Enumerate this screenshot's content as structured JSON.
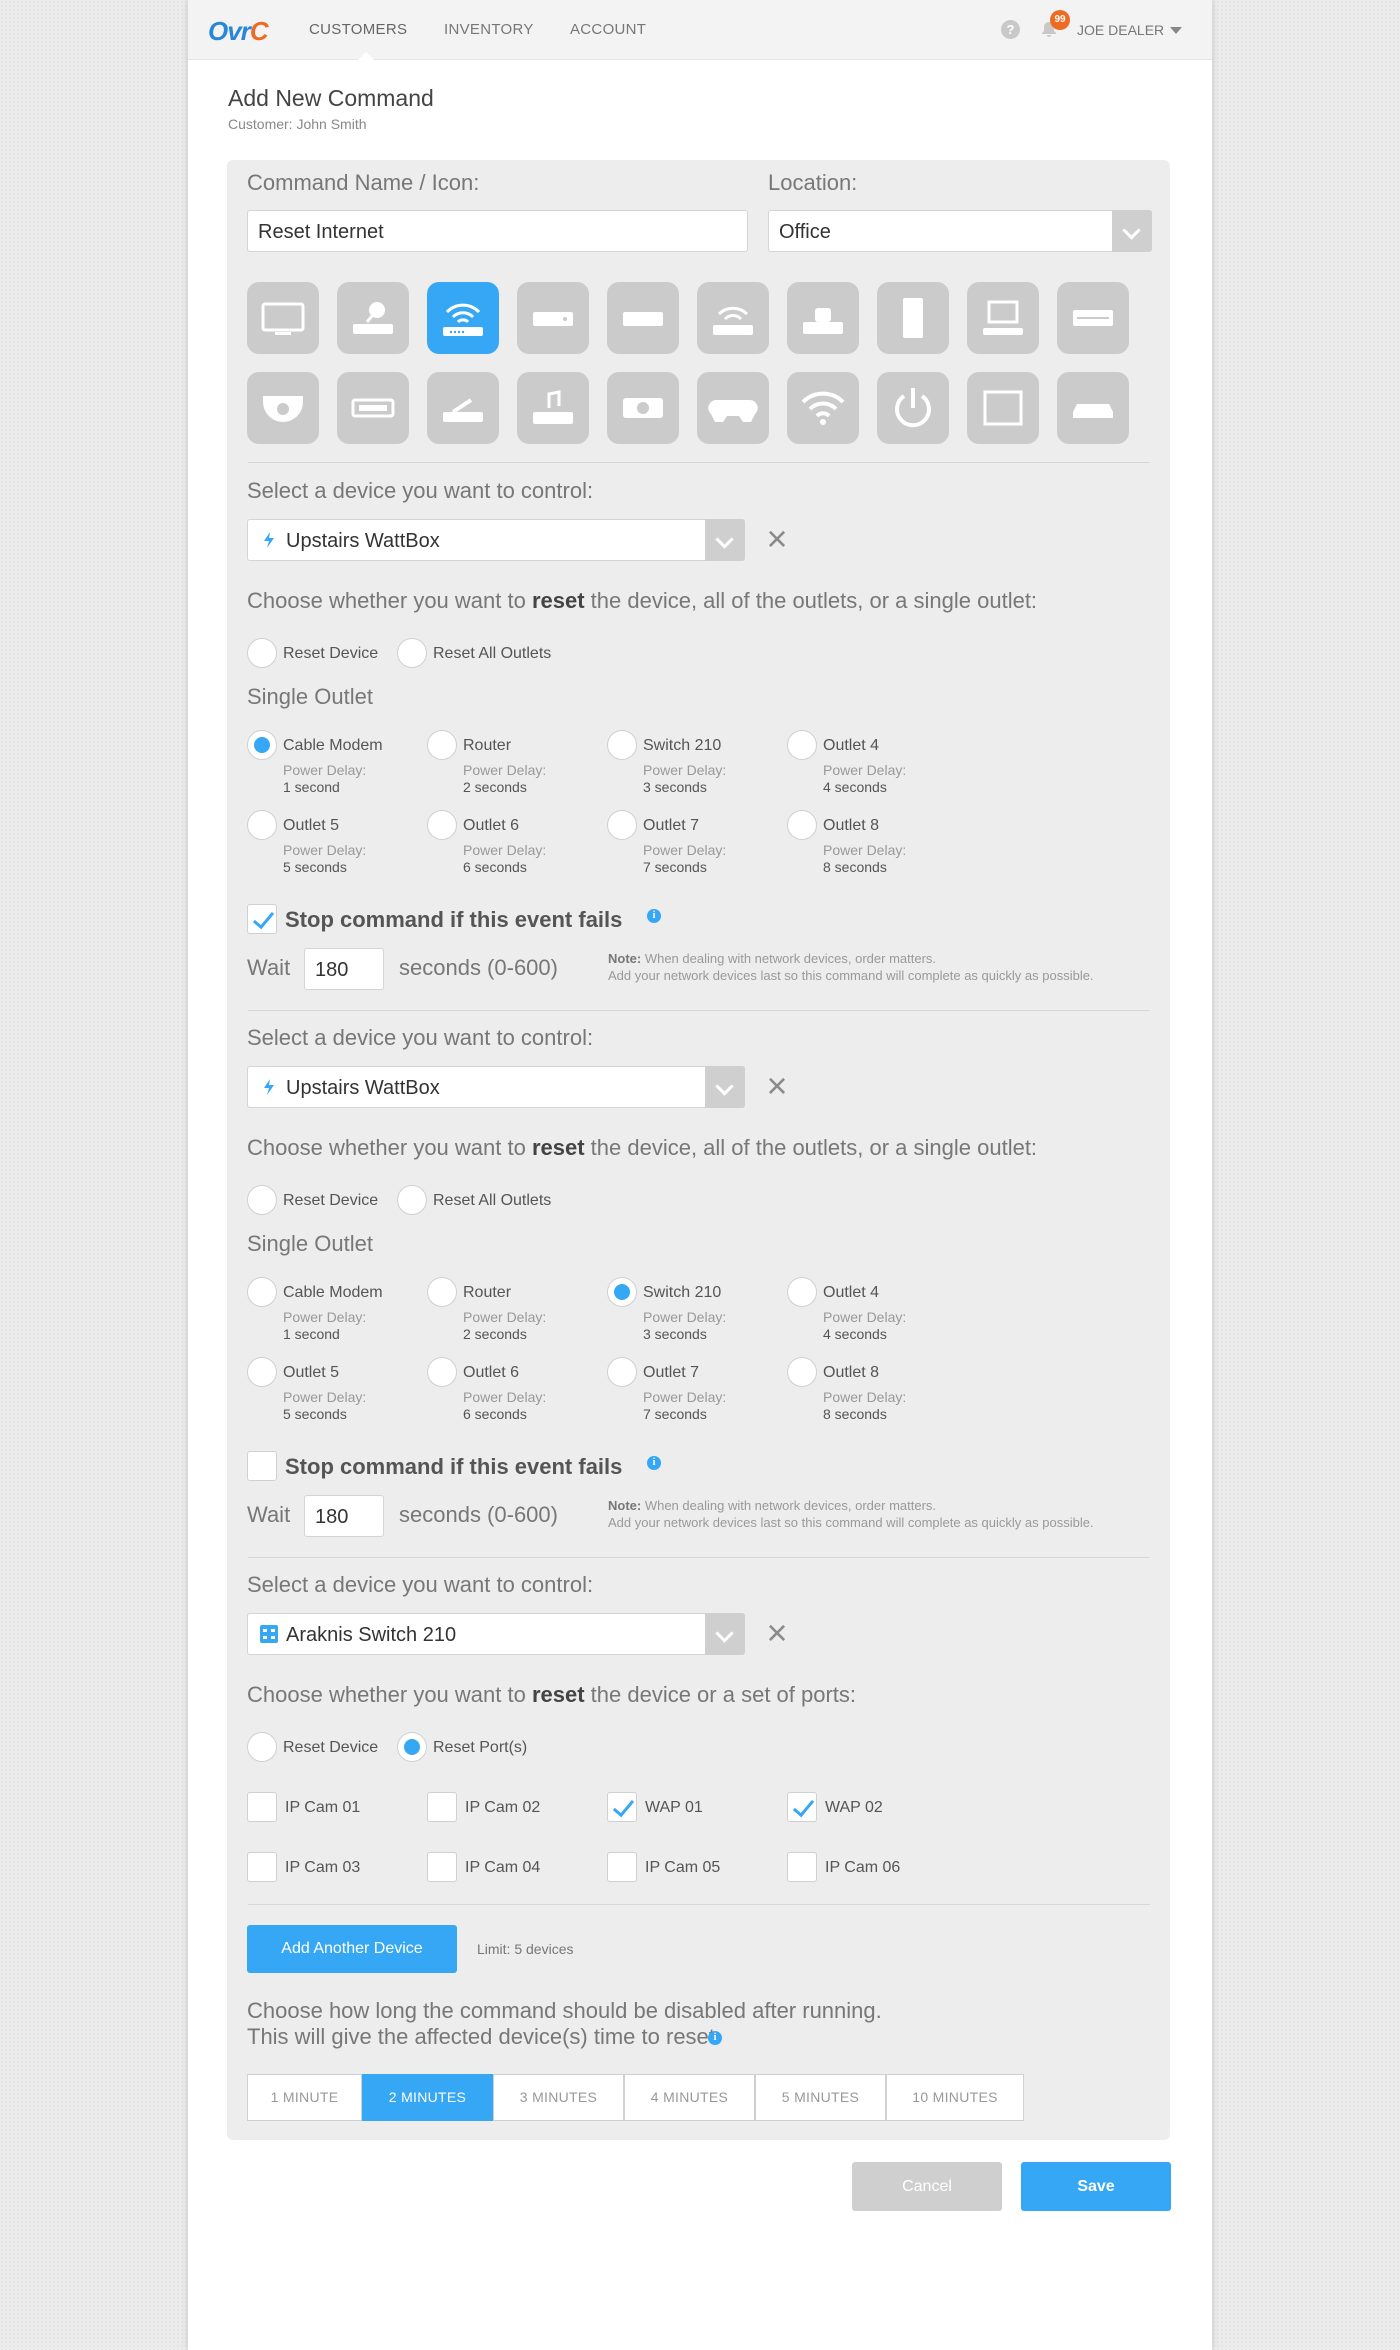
{
  "app": {
    "logo": "OvrC",
    "nav": [
      "CUSTOMERS",
      "INVENTORY",
      "ACCOUNT"
    ],
    "help_icon": "?",
    "notifications_count": "99",
    "user": "JOE DEALER"
  },
  "page": {
    "title": "Add New Command",
    "customer": "Customer: John Smith"
  },
  "form": {
    "name_label": "Command Name / Icon:",
    "name_value": "Reset Internet",
    "location_label": "Location:",
    "location_value": "Office",
    "icons_row1": [
      "tv-icon",
      "satellite-receiver-icon",
      "wireless-router-icon",
      "cable-box-icon",
      "media-box-icon",
      "access-point-icon",
      "camera-dock-icon",
      "desktop-tower-icon",
      "computer-icon",
      "amplifier-icon"
    ],
    "icons_row2": [
      "dome-camera-icon",
      "receiver-icon",
      "game-device-icon",
      "music-device-icon",
      "projector-icon",
      "gamepad-icon",
      "wifi-icon",
      "power-icon",
      "screen-icon",
      "network-switch-icon"
    ],
    "selected_icon": "wireless-router-icon"
  },
  "devices": [
    {
      "select_label": "Select a device you want to control:",
      "device_name": "Upstairs WattBox",
      "device_icon": "lightning-icon",
      "choose_prefix": "Choose whether you want to ",
      "choose_bold": "reset",
      "choose_suffix": " the device, all of the outlets, or a single outlet:",
      "reset_device": "Reset Device",
      "reset_all": "Reset All Outlets",
      "single_outlet": "Single Outlet",
      "delay_label": "Power Delay:",
      "outlets": [
        {
          "name": "Cable Modem",
          "delay": "1 second",
          "selected": true
        },
        {
          "name": "Router",
          "delay": "2 seconds",
          "selected": false
        },
        {
          "name": "Switch 210",
          "delay": "3 seconds",
          "selected": false
        },
        {
          "name": "Outlet 4",
          "delay": "4 seconds",
          "selected": false
        },
        {
          "name": "Outlet 5",
          "delay": "5 seconds",
          "selected": false
        },
        {
          "name": "Outlet 6",
          "delay": "6 seconds",
          "selected": false
        },
        {
          "name": "Outlet 7",
          "delay": "7 seconds",
          "selected": false
        },
        {
          "name": "Outlet 8",
          "delay": "8 seconds",
          "selected": false
        }
      ],
      "stop_label": "Stop command if this event fails",
      "stop_checked": true,
      "wait_label": "Wait",
      "wait_value": "180",
      "seconds_label": "seconds (0-600)",
      "note_bold": "Note:",
      "note_line1": " When dealing with network devices, order matters.",
      "note_line2": "Add your network devices last so this command will complete as quickly as possible."
    },
    {
      "select_label": "Select a device you want to control:",
      "device_name": "Upstairs WattBox",
      "device_icon": "lightning-icon",
      "choose_prefix": "Choose whether you want to ",
      "choose_bold": "reset",
      "choose_suffix": " the device, all of the outlets, or a single outlet:",
      "reset_device": "Reset Device",
      "reset_all": "Reset All Outlets",
      "single_outlet": "Single Outlet",
      "delay_label": "Power Delay:",
      "outlets": [
        {
          "name": "Cable Modem",
          "delay": "1 second",
          "selected": false
        },
        {
          "name": "Router",
          "delay": "2 seconds",
          "selected": false
        },
        {
          "name": "Switch 210",
          "delay": "3 seconds",
          "selected": true
        },
        {
          "name": "Outlet 4",
          "delay": "4 seconds",
          "selected": false
        },
        {
          "name": "Outlet 5",
          "delay": "5 seconds",
          "selected": false
        },
        {
          "name": "Outlet 6",
          "delay": "6 seconds",
          "selected": false
        },
        {
          "name": "Outlet 7",
          "delay": "7 seconds",
          "selected": false
        },
        {
          "name": "Outlet 8",
          "delay": "8 seconds",
          "selected": false
        }
      ],
      "stop_label": "Stop command if this event fails",
      "stop_checked": false,
      "wait_label": "Wait",
      "wait_value": "180",
      "seconds_label": "seconds (0-600)",
      "note_bold": "Note:",
      "note_line1": " When dealing with network devices, order matters.",
      "note_line2": "Add your network devices last so this command will complete as quickly as possible."
    },
    {
      "select_label": "Select a device you want to control:",
      "device_name": "Araknis Switch 210",
      "device_icon": "switch-icon",
      "choose_prefix": "Choose whether you want to ",
      "choose_bold": "reset",
      "choose_suffix": " the device or a set of ports:",
      "reset_device": "Reset Device",
      "reset_ports": "Reset Port(s)",
      "ports": [
        {
          "name": "IP Cam 01",
          "checked": false
        },
        {
          "name": "IP Cam 02",
          "checked": false
        },
        {
          "name": "WAP 01",
          "checked": true
        },
        {
          "name": "WAP 02",
          "checked": true
        },
        {
          "name": "IP Cam 03",
          "checked": false
        },
        {
          "name": "IP Cam 04",
          "checked": false
        },
        {
          "name": "IP Cam 05",
          "checked": false
        },
        {
          "name": "IP Cam 06",
          "checked": false
        }
      ]
    }
  ],
  "add_device": {
    "button": "Add Another Device",
    "limit": "Limit: 5 devices"
  },
  "disable": {
    "line1": "Choose how long the command should be disabled after running.",
    "line2": "This will give the affected device(s) time to reset.",
    "options": [
      "1 MINUTE",
      "2 MINUTES",
      "3 MINUTES",
      "4 MINUTES",
      "5 MINUTES",
      "10 MINUTES"
    ],
    "selected": "2 MINUTES"
  },
  "actions": {
    "cancel": "Cancel",
    "save": "Save"
  },
  "colors": {
    "accent": "#35a7f5",
    "badge": "#ef6b22",
    "icon_bg": "#cbcbcb",
    "panel": "#ededed"
  }
}
